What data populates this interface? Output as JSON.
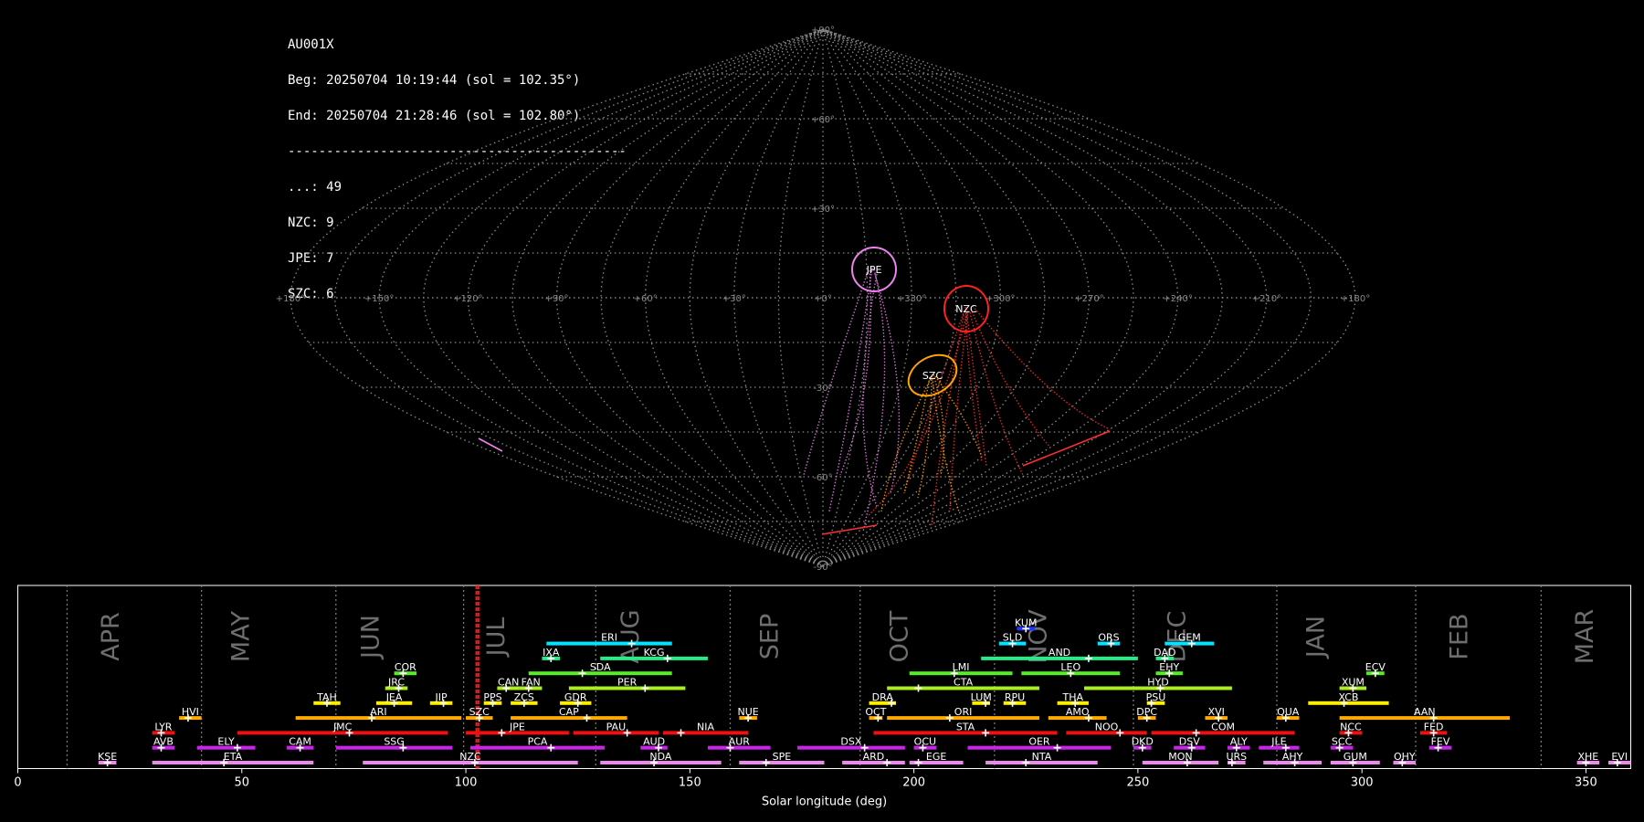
{
  "header": {
    "station": "AU001X",
    "begin": "Beg: 20250704 10:19:44 (sol = 102.35°)",
    "end": "End: 20250704 21:28:46 (sol = 102.80°)",
    "separator": "--------------------------------------------",
    "counts": [
      {
        "label": "...: 49"
      },
      {
        "label": "NZC: 9"
      },
      {
        "label": "JPE: 7"
      },
      {
        "label": "SZC: 6"
      }
    ]
  },
  "sky_map": {
    "projection": "sinusoidal",
    "lon_labels": [
      "+180°",
      "+150°",
      "+120°",
      "+90°",
      "+60°",
      "+30°",
      "+0°",
      "+330°",
      "+300°",
      "+270°",
      "+240°",
      "+210°",
      "+180°"
    ],
    "lat_labels": [
      "+90°",
      "+60°",
      "+30°",
      "-30°",
      "-60°",
      "-90°"
    ],
    "radiants": [
      {
        "code": "JPE",
        "color": "#ee82ee"
      },
      {
        "code": "NZC",
        "color": "#ff2020"
      },
      {
        "code": "SZC",
        "color": "#ffa500"
      }
    ]
  },
  "chart_data": {
    "type": "timeline",
    "xlabel": "Solar longitude (deg)",
    "xlim": [
      0,
      360
    ],
    "xticks": [
      0,
      50,
      100,
      150,
      200,
      250,
      300,
      350
    ],
    "current_sol": [
      102.35,
      102.8
    ],
    "months": [
      {
        "label": "APR",
        "boundary": 11,
        "center": 25
      },
      {
        "label": "MAY",
        "boundary": 41,
        "center": 54
      },
      {
        "label": "JUN",
        "boundary": 71,
        "center": 83
      },
      {
        "label": "JUL",
        "boundary": 99.5,
        "center": 111
      },
      {
        "label": "AUG",
        "boundary": 129,
        "center": 141
      },
      {
        "label": "SEP",
        "boundary": 159,
        "center": 172
      },
      {
        "label": "OCT",
        "boundary": 188,
        "center": 201
      },
      {
        "label": "NOV",
        "boundary": 218,
        "center": 232
      },
      {
        "label": "DEC",
        "boundary": 249,
        "center": 263
      },
      {
        "label": "JAN",
        "boundary": 281,
        "center": 294
      },
      {
        "label": "FEB",
        "boundary": 312,
        "center": 326
      },
      {
        "label": "MAR",
        "boundary": 340,
        "center": 354
      }
    ],
    "showers": [
      {
        "code": "KUM",
        "start": 223,
        "end": 227,
        "peak": 225,
        "row": 9,
        "color": "#2233ff"
      },
      {
        "code": "ERI",
        "start": 118,
        "end": 146,
        "peak": 137,
        "row": 8,
        "color": "#00e5ff"
      },
      {
        "code": "SLD",
        "start": 219,
        "end": 225,
        "peak": 222,
        "row": 8,
        "color": "#00e5ff"
      },
      {
        "code": "ORS",
        "start": 241,
        "end": 246,
        "peak": 244,
        "row": 8,
        "color": "#00e5ff"
      },
      {
        "code": "GEM",
        "start": 256,
        "end": 267,
        "peak": 262,
        "row": 8,
        "color": "#00e5ff"
      },
      {
        "code": "IXA",
        "start": 117,
        "end": 121,
        "peak": 119,
        "row": 7,
        "color": "#22ee88"
      },
      {
        "code": "KCG",
        "start": 130,
        "end": 154,
        "peak": 145,
        "row": 7,
        "color": "#22ee88"
      },
      {
        "code": "AND",
        "start": 215,
        "end": 250,
        "peak": 239,
        "row": 7,
        "color": "#22ee88"
      },
      {
        "code": "DAD",
        "start": 254,
        "end": 258,
        "peak": 256,
        "row": 7,
        "color": "#22ee88"
      },
      {
        "code": "COR",
        "start": 84,
        "end": 89,
        "peak": 86,
        "row": 6,
        "color": "#55ee22"
      },
      {
        "code": "SDA",
        "start": 114,
        "end": 146,
        "peak": 126,
        "row": 6,
        "color": "#55ee22"
      },
      {
        "code": "LMI",
        "start": 199,
        "end": 222,
        "peak": 209,
        "row": 6,
        "color": "#55ee22"
      },
      {
        "code": "LEO",
        "start": 224,
        "end": 246,
        "peak": 235,
        "row": 6,
        "color": "#55ee22"
      },
      {
        "code": "EHY",
        "start": 254,
        "end": 260,
        "peak": 257,
        "row": 6,
        "color": "#55ee22"
      },
      {
        "code": "ECV",
        "start": 301,
        "end": 305,
        "peak": 303,
        "row": 6,
        "color": "#55ee22"
      },
      {
        "code": "JRC",
        "start": 82,
        "end": 87,
        "peak": 85,
        "row": 5,
        "color": "#aaee22"
      },
      {
        "code": "CAN",
        "start": 107,
        "end": 112,
        "peak": 109,
        "row": 5,
        "color": "#aaee22"
      },
      {
        "code": "FAN",
        "start": 112,
        "end": 117,
        "peak": 114,
        "row": 5,
        "color": "#aaee22"
      },
      {
        "code": "PER",
        "start": 123,
        "end": 149,
        "peak": 140,
        "row": 5,
        "color": "#aaee22"
      },
      {
        "code": "CTA",
        "start": 194,
        "end": 228,
        "peak": 201,
        "row": 5,
        "color": "#aaee22"
      },
      {
        "code": "HYD",
        "start": 238,
        "end": 271,
        "peak": 255,
        "row": 5,
        "color": "#aaee22"
      },
      {
        "code": "XUM",
        "start": 295,
        "end": 301,
        "peak": 298,
        "row": 5,
        "color": "#aaee22"
      },
      {
        "code": "TAH",
        "start": 66,
        "end": 72,
        "peak": 69,
        "row": 4,
        "color": "#ffee00"
      },
      {
        "code": "JEA",
        "start": 80,
        "end": 88,
        "peak": 84,
        "row": 4,
        "color": "#ffee00"
      },
      {
        "code": "JIP",
        "start": 92,
        "end": 97,
        "peak": 95,
        "row": 4,
        "color": "#ffee00"
      },
      {
        "code": "PPS",
        "start": 104,
        "end": 108,
        "peak": 106,
        "row": 4,
        "color": "#ffee00"
      },
      {
        "code": "ZCS",
        "start": 110,
        "end": 116,
        "peak": 113,
        "row": 4,
        "color": "#ffee00"
      },
      {
        "code": "GDR",
        "start": 121,
        "end": 128,
        "peak": 125,
        "row": 4,
        "color": "#ffee00"
      },
      {
        "code": "DRA",
        "start": 190,
        "end": 196,
        "peak": 195,
        "row": 4,
        "color": "#ffee00"
      },
      {
        "code": "LUM",
        "start": 213,
        "end": 217,
        "peak": 216,
        "row": 4,
        "color": "#ffee00"
      },
      {
        "code": "RPU",
        "start": 220,
        "end": 225,
        "peak": 222,
        "row": 4,
        "color": "#ffee00"
      },
      {
        "code": "THA",
        "start": 232,
        "end": 239,
        "peak": 236,
        "row": 4,
        "color": "#ffee00"
      },
      {
        "code": "PSU",
        "start": 252,
        "end": 256,
        "peak": 253,
        "row": 4,
        "color": "#ffee00"
      },
      {
        "code": "XCB",
        "start": 288,
        "end": 306,
        "peak": 296,
        "row": 4,
        "color": "#ffee00"
      },
      {
        "code": "HVI",
        "start": 36,
        "end": 41,
        "peak": 38,
        "row": 3,
        "color": "#ffaa00"
      },
      {
        "code": "ARI",
        "start": 62,
        "end": 99,
        "peak": 79,
        "row": 3,
        "color": "#ffaa00"
      },
      {
        "code": "SZC",
        "start": 100,
        "end": 106,
        "peak": 103,
        "row": 3,
        "color": "#ffaa00"
      },
      {
        "code": "CAP",
        "start": 110,
        "end": 136,
        "peak": 127,
        "row": 3,
        "color": "#ffaa00"
      },
      {
        "code": "NUE",
        "start": 161,
        "end": 165,
        "peak": 163,
        "row": 3,
        "color": "#ffaa00"
      },
      {
        "code": "OCT",
        "start": 190,
        "end": 193,
        "peak": 192,
        "row": 3,
        "color": "#ffaa00"
      },
      {
        "code": "ORI",
        "start": 194,
        "end": 228,
        "peak": 208,
        "row": 3,
        "color": "#ffaa00"
      },
      {
        "code": "AMO",
        "start": 230,
        "end": 243,
        "peak": 239,
        "row": 3,
        "color": "#ffaa00"
      },
      {
        "code": "DPC",
        "start": 250,
        "end": 254,
        "peak": 252,
        "row": 3,
        "color": "#ffaa00"
      },
      {
        "code": "XVI",
        "start": 265,
        "end": 270,
        "peak": 268,
        "row": 3,
        "color": "#ffaa00"
      },
      {
        "code": "QUA",
        "start": 281,
        "end": 286,
        "peak": 283,
        "row": 3,
        "color": "#ffaa00"
      },
      {
        "code": "AAN",
        "start": 295,
        "end": 333,
        "peak": 316,
        "row": 3,
        "color": "#ffaa00"
      },
      {
        "code": "LYR",
        "start": 30,
        "end": 35,
        "peak": 32,
        "row": 2,
        "color": "#ee1111"
      },
      {
        "code": "JMC",
        "start": 49,
        "end": 96,
        "peak": 74,
        "row": 2,
        "color": "#ee1111"
      },
      {
        "code": "JPE",
        "start": 100,
        "end": 123,
        "peak": 108,
        "row": 2,
        "color": "#ee1111"
      },
      {
        "code": "PAU",
        "start": 124,
        "end": 143,
        "peak": 136,
        "row": 2,
        "color": "#ee1111"
      },
      {
        "code": "NIA",
        "start": 144,
        "end": 163,
        "peak": 148,
        "row": 2,
        "color": "#ee1111"
      },
      {
        "code": "STA",
        "start": 191,
        "end": 232,
        "peak": 216,
        "row": 2,
        "color": "#ee1111"
      },
      {
        "code": "NOO",
        "start": 234,
        "end": 252,
        "peak": 246,
        "row": 2,
        "color": "#ee1111"
      },
      {
        "code": "COM",
        "start": 253,
        "end": 285,
        "peak": 263,
        "row": 2,
        "color": "#ee1111"
      },
      {
        "code": "NCC",
        "start": 295,
        "end": 300,
        "peak": 297,
        "row": 2,
        "color": "#ee1111"
      },
      {
        "code": "FED",
        "start": 313,
        "end": 319,
        "peak": 316,
        "row": 2,
        "color": "#ee1111"
      },
      {
        "code": "AVB",
        "start": 30,
        "end": 35,
        "peak": 32,
        "row": 1,
        "color": "#cc22ee"
      },
      {
        "code": "ELY",
        "start": 40,
        "end": 53,
        "peak": 49,
        "row": 1,
        "color": "#cc22ee"
      },
      {
        "code": "CAM",
        "start": 60,
        "end": 66,
        "peak": 63,
        "row": 1,
        "color": "#cc22ee"
      },
      {
        "code": "SSG",
        "start": 71,
        "end": 97,
        "peak": 86,
        "row": 1,
        "color": "#cc22ee"
      },
      {
        "code": "PCA",
        "start": 101,
        "end": 131,
        "peak": 119,
        "row": 1,
        "color": "#cc22ee"
      },
      {
        "code": "AUD",
        "start": 139,
        "end": 145,
        "peak": 143,
        "row": 1,
        "color": "#cc22ee"
      },
      {
        "code": "AUR",
        "start": 154,
        "end": 168,
        "peak": 159,
        "row": 1,
        "color": "#cc22ee"
      },
      {
        "code": "DSX",
        "start": 174,
        "end": 198,
        "peak": 189,
        "row": 1,
        "color": "#cc22ee"
      },
      {
        "code": "OCU",
        "start": 200,
        "end": 205,
        "peak": 202,
        "row": 1,
        "color": "#cc22ee"
      },
      {
        "code": "OER",
        "start": 212,
        "end": 244,
        "peak": 232,
        "row": 1,
        "color": "#cc22ee"
      },
      {
        "code": "DKD",
        "start": 249,
        "end": 253,
        "peak": 251,
        "row": 1,
        "color": "#cc22ee"
      },
      {
        "code": "DSV",
        "start": 258,
        "end": 265,
        "peak": 262,
        "row": 1,
        "color": "#cc22ee"
      },
      {
        "code": "ALY",
        "start": 270,
        "end": 275,
        "peak": 272,
        "row": 1,
        "color": "#cc22ee"
      },
      {
        "code": "JLE",
        "start": 277,
        "end": 286,
        "peak": 283,
        "row": 1,
        "color": "#cc22ee"
      },
      {
        "code": "SCC",
        "start": 293,
        "end": 298,
        "peak": 295,
        "row": 1,
        "color": "#cc22ee"
      },
      {
        "code": "FEV",
        "start": 315,
        "end": 320,
        "peak": 317,
        "row": 1,
        "color": "#cc22ee"
      },
      {
        "code": "KSE",
        "start": 18,
        "end": 22,
        "peak": 20,
        "row": 0,
        "color": "#ee88ee"
      },
      {
        "code": "ETA",
        "start": 30,
        "end": 66,
        "peak": 46,
        "row": 0,
        "color": "#ee88ee"
      },
      {
        "code": "NZC",
        "start": 77,
        "end": 125,
        "peak": 102,
        "row": 0,
        "color": "#ee88ee"
      },
      {
        "code": "NDA",
        "start": 130,
        "end": 157,
        "peak": 142,
        "row": 0,
        "color": "#ee88ee"
      },
      {
        "code": "SPE",
        "start": 161,
        "end": 180,
        "peak": 167,
        "row": 0,
        "color": "#ee88ee"
      },
      {
        "code": "ARD",
        "start": 184,
        "end": 198,
        "peak": 194,
        "row": 0,
        "color": "#ee88ee"
      },
      {
        "code": "EGE",
        "start": 199,
        "end": 211,
        "peak": 201,
        "row": 0,
        "color": "#ee88ee"
      },
      {
        "code": "NTA",
        "start": 216,
        "end": 241,
        "peak": 225,
        "row": 0,
        "color": "#ee88ee"
      },
      {
        "code": "MON",
        "start": 251,
        "end": 268,
        "peak": 261,
        "row": 0,
        "color": "#ee88ee"
      },
      {
        "code": "URS",
        "start": 270,
        "end": 274,
        "peak": 271,
        "row": 0,
        "color": "#ee88ee"
      },
      {
        "code": "AHY",
        "start": 278,
        "end": 291,
        "peak": 285,
        "row": 0,
        "color": "#ee88ee"
      },
      {
        "code": "GUM",
        "start": 293,
        "end": 304,
        "peak": 298,
        "row": 0,
        "color": "#ee88ee"
      },
      {
        "code": "OHY",
        "start": 307,
        "end": 312,
        "peak": 309,
        "row": 0,
        "color": "#ee88ee"
      },
      {
        "code": "XHE",
        "start": 348,
        "end": 353,
        "peak": 350,
        "row": 0,
        "color": "#ee88ee"
      },
      {
        "code": "EVI",
        "start": 355,
        "end": 360,
        "peak": 357,
        "row": 0,
        "color": "#ee88ee"
      }
    ]
  }
}
